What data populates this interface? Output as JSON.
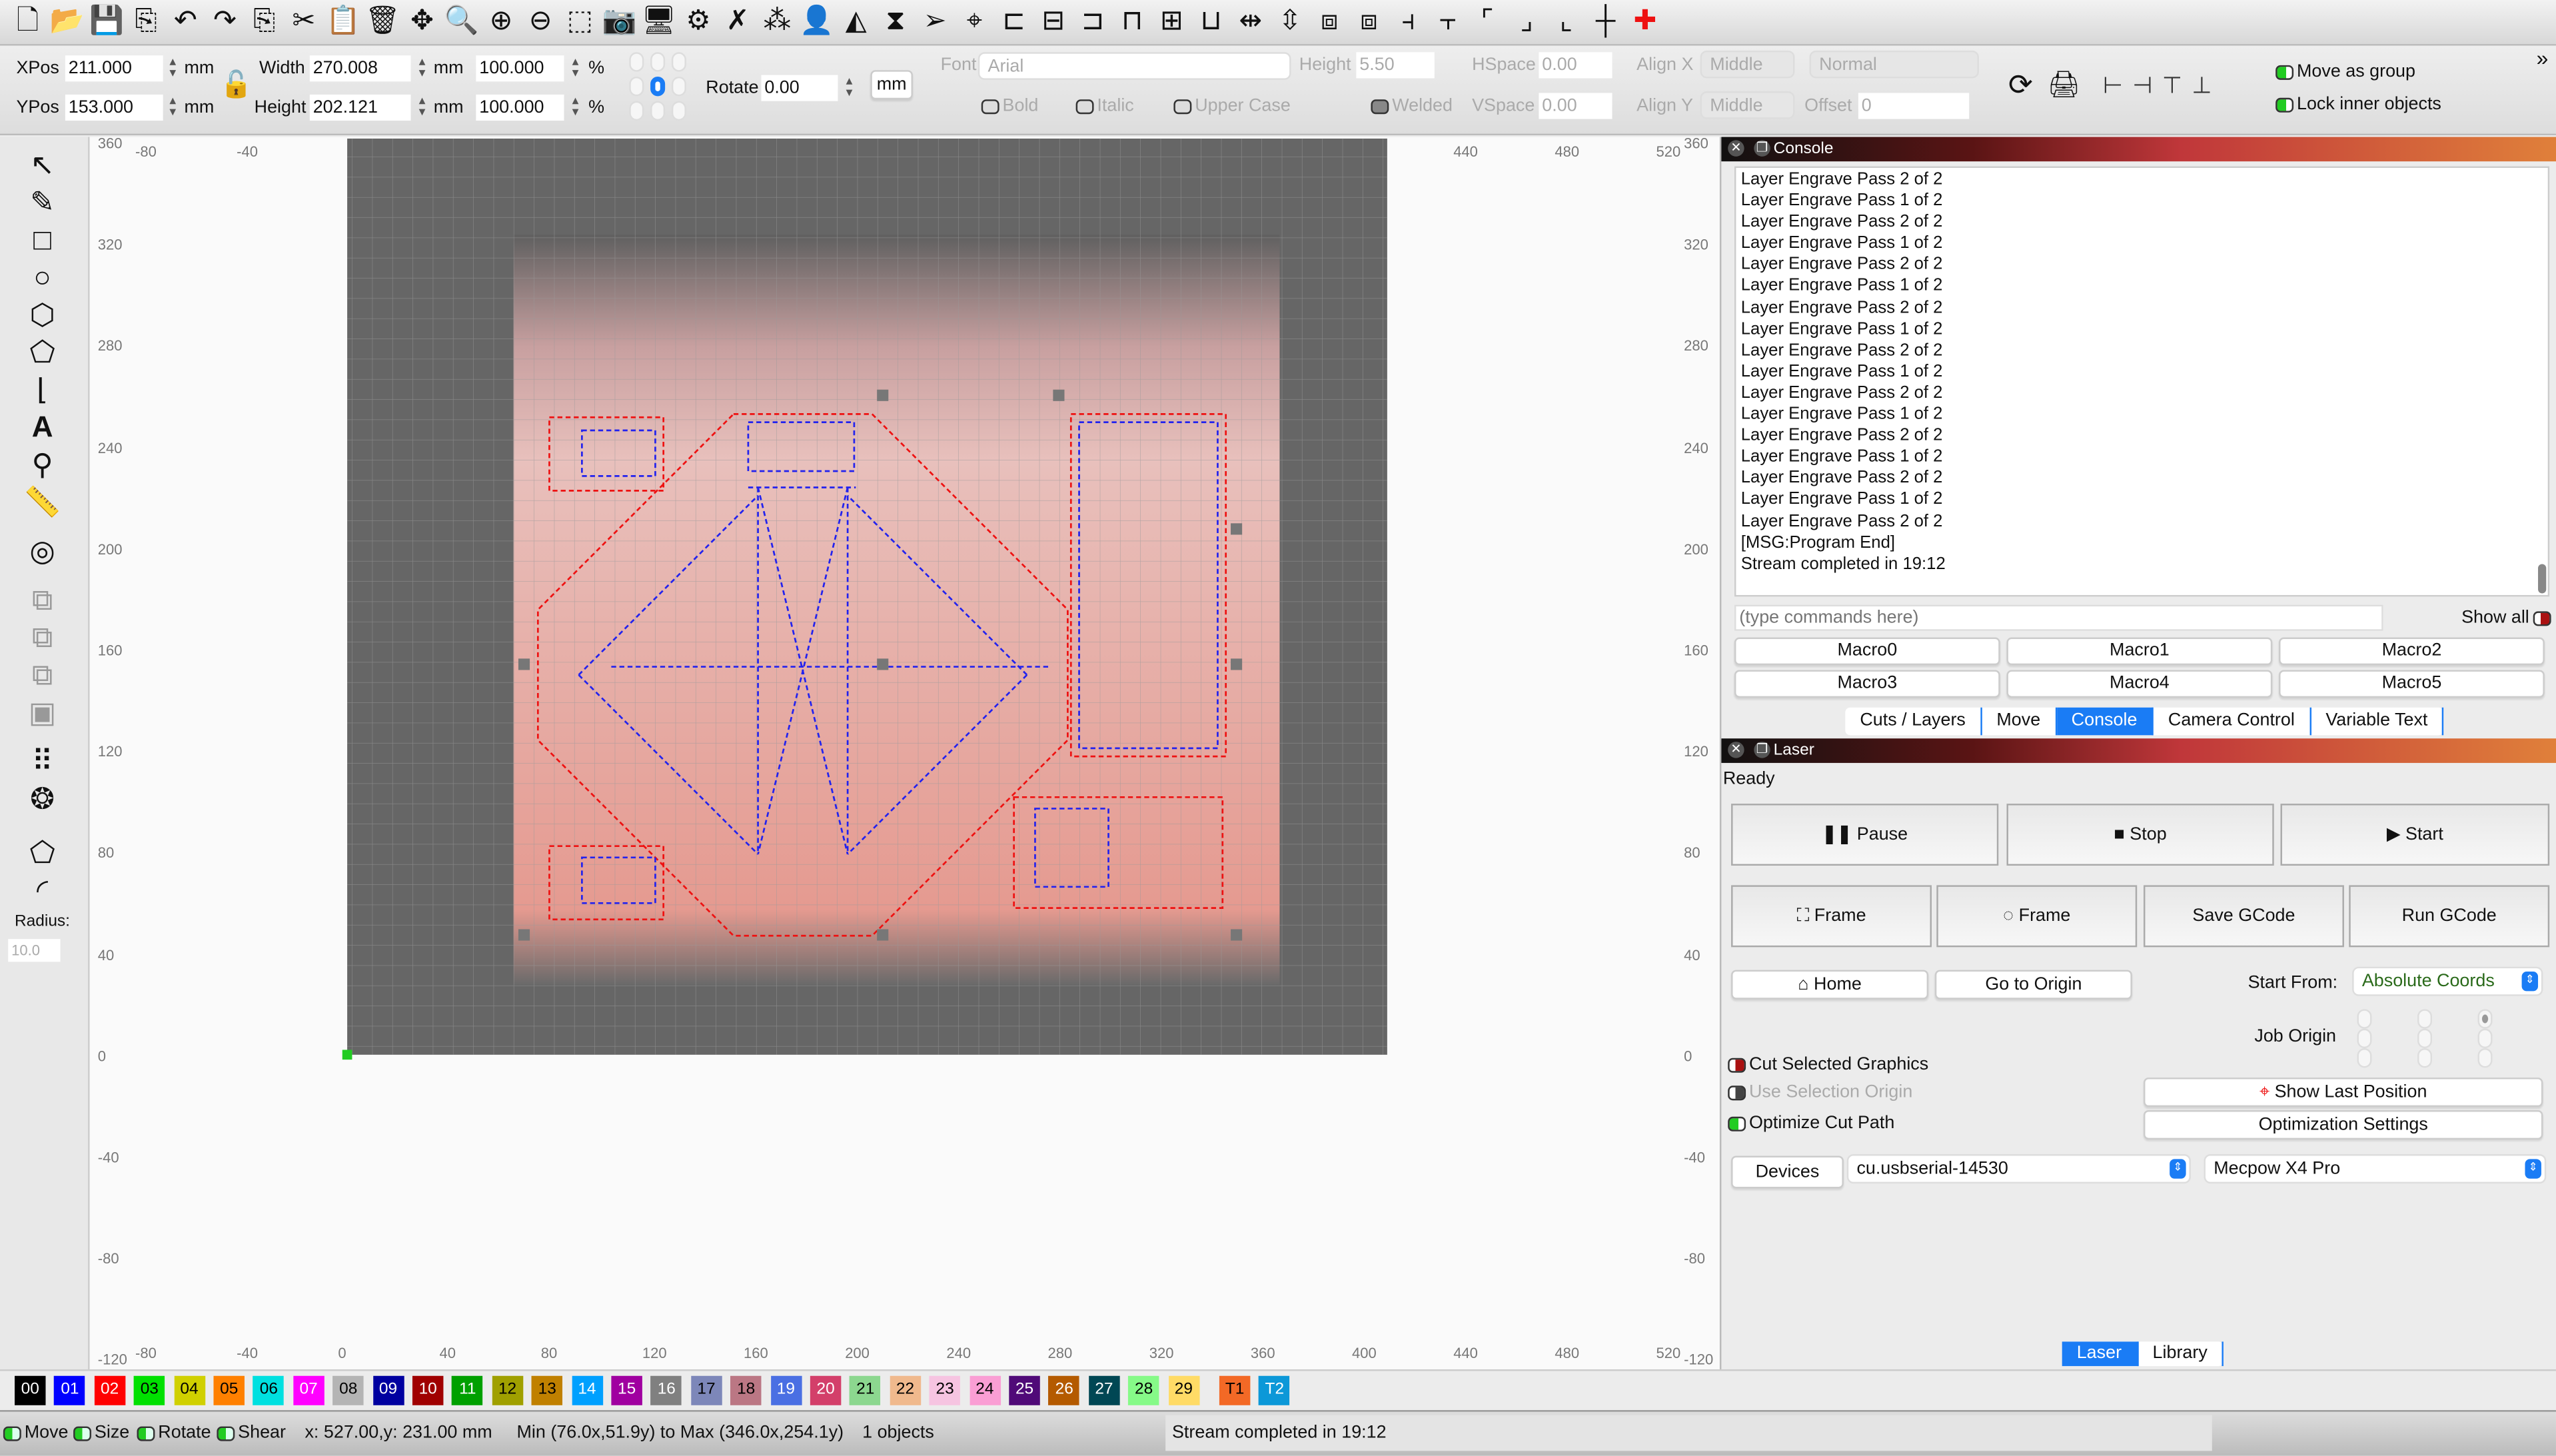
{
  "toolbar": {
    "icons": [
      "new-file-icon",
      "open-folder-icon",
      "save-icon",
      "import-icon",
      "undo-icon",
      "redo-icon",
      "copy-icon",
      "cut-icon",
      "paste-icon",
      "delete-icon",
      "move-icon",
      "zoom-fit-icon",
      "zoom-in-icon",
      "zoom-out-icon",
      "frame-selection-icon",
      "camera-icon",
      "monitor-icon",
      "settings-icon",
      "tools-icon",
      "group-icon",
      "user-icon",
      "mirror-horizontal-icon",
      "mirror-vertical-icon",
      "send-icon",
      "target-icon",
      "align-left-icon",
      "align-center-icon",
      "align-right-icon",
      "align-top-icon",
      "align-middle-icon",
      "align-bottom-icon",
      "distribute-h-icon",
      "distribute-v-icon",
      "move-together-h-icon",
      "move-together-v-icon",
      "dock-h-icon",
      "dock-v-icon",
      "corner-tl-icon",
      "corner-br-icon",
      "corner-bl-icon",
      "center-icon",
      "laser-position-icon"
    ]
  },
  "props": {
    "xpos_label": "XPos",
    "xpos": "211.000",
    "ypos_label": "YPos",
    "ypos": "153.000",
    "unit": "mm",
    "width_label": "Width",
    "width": "270.008",
    "height_label": "Height",
    "height": "202.121",
    "scale_w": "100.000",
    "scale_h": "100.000",
    "pct": "%",
    "rotate_label": "Rotate",
    "rotate": "0.00",
    "mm_button": "mm",
    "font_label": "Font",
    "font": "Arial",
    "font_height_label": "Height",
    "font_height": "5.50",
    "hspace_label": "HSpace",
    "hspace": "0.00",
    "vspace_label": "VSpace",
    "vspace": "0.00",
    "alignx_label": "Align X",
    "alignx": "Middle",
    "aligny_label": "Align Y",
    "aligny": "Middle",
    "style": "Normal",
    "offset_label": "Offset",
    "offset": "0",
    "bold": "Bold",
    "italic": "Italic",
    "upper": "Upper Case",
    "welded": "Welded",
    "move_group": "Move as group",
    "lock_inner": "Lock inner objects"
  },
  "left_tools": {
    "radius_label": "Radius:",
    "radius": "10.0"
  },
  "ruler": {
    "x_ticks": [
      "-80",
      "-40",
      "0",
      "40",
      "80",
      "120",
      "160",
      "200",
      "240",
      "280",
      "320",
      "360",
      "400",
      "440",
      "480",
      "520"
    ],
    "y_ticks": [
      "360",
      "320",
      "280",
      "240",
      "200",
      "160",
      "120",
      "80",
      "40",
      "0",
      "-40",
      "-80",
      "-120"
    ]
  },
  "console": {
    "title": "Console",
    "lines": [
      "Layer Engrave Pass 2 of 2",
      "Layer Engrave Pass 1 of 2",
      "Layer Engrave Pass 2 of 2",
      "Layer Engrave Pass 1 of 2",
      "Layer Engrave Pass 2 of 2",
      "Layer Engrave Pass 1 of 2",
      "Layer Engrave Pass 2 of 2",
      "Layer Engrave Pass 1 of 2",
      "Layer Engrave Pass 2 of 2",
      "Layer Engrave Pass 1 of 2",
      "Layer Engrave Pass 2 of 2",
      "Layer Engrave Pass 1 of 2",
      "Layer Engrave Pass 2 of 2",
      "Layer Engrave Pass 1 of 2",
      "Layer Engrave Pass 2 of 2",
      "Layer Engrave Pass 1 of 2",
      "Layer Engrave Pass 2 of 2",
      "[MSG:Program End]",
      "Stream completed in 19:12"
    ],
    "placeholder": "(type commands here)",
    "show_all": "Show all",
    "macros": [
      "Macro0",
      "Macro1",
      "Macro2",
      "Macro3",
      "Macro4",
      "Macro5"
    ]
  },
  "tabs": [
    {
      "label": "Cuts / Layers",
      "active": false
    },
    {
      "label": "Move",
      "active": false
    },
    {
      "label": "Console",
      "active": true
    },
    {
      "label": "Camera Control",
      "active": false
    },
    {
      "label": "Variable Text",
      "active": false
    }
  ],
  "laser": {
    "title": "Laser",
    "state": "Ready",
    "pause": "Pause",
    "stop": "Stop",
    "start": "Start",
    "frame1": "Frame",
    "frame2": "Frame",
    "save_gcode": "Save GCode",
    "run_gcode": "Run GCode",
    "home": "Home",
    "go_origin": "Go to Origin",
    "start_from_label": "Start From:",
    "start_from": "Absolute Coords",
    "job_origin_label": "Job Origin",
    "cut_selected": "Cut Selected Graphics",
    "use_sel_origin": "Use Selection Origin",
    "optimize": "Optimize Cut Path",
    "show_last": "Show Last Position",
    "opt_settings": "Optimization Settings",
    "devices": "Devices",
    "port": "cu.usbserial-14530",
    "device": "Mecpow X4 Pro"
  },
  "bottom_tabs": [
    {
      "label": "Laser",
      "active": true
    },
    {
      "label": "Library",
      "active": false
    }
  ],
  "palette": [
    {
      "l": "00",
      "c": "#000000",
      "t": "#fff"
    },
    {
      "l": "01",
      "c": "#0000ff",
      "t": "#fff"
    },
    {
      "l": "02",
      "c": "#ff0000",
      "t": "#fff"
    },
    {
      "l": "03",
      "c": "#00e000",
      "t": "#000"
    },
    {
      "l": "04",
      "c": "#d0d000",
      "t": "#000"
    },
    {
      "l": "05",
      "c": "#ff8000",
      "t": "#000"
    },
    {
      "l": "06",
      "c": "#00e0e0",
      "t": "#000"
    },
    {
      "l": "07",
      "c": "#ff00ff",
      "t": "#fff"
    },
    {
      "l": "08",
      "c": "#b4b4b4",
      "t": "#000"
    },
    {
      "l": "09",
      "c": "#0000a0",
      "t": "#fff"
    },
    {
      "l": "10",
      "c": "#a00000",
      "t": "#fff"
    },
    {
      "l": "11",
      "c": "#00a000",
      "t": "#fff"
    },
    {
      "l": "12",
      "c": "#a0a000",
      "t": "#000"
    },
    {
      "l": "13",
      "c": "#c08000",
      "t": "#000"
    },
    {
      "l": "14",
      "c": "#00a0ff",
      "t": "#fff"
    },
    {
      "l": "15",
      "c": "#a000a0",
      "t": "#fff"
    },
    {
      "l": "16",
      "c": "#808080",
      "t": "#fff"
    },
    {
      "l": "17",
      "c": "#7d87b9",
      "t": "#000"
    },
    {
      "l": "18",
      "c": "#bb7784",
      "t": "#000"
    },
    {
      "l": "19",
      "c": "#4a6fe3",
      "t": "#fff"
    },
    {
      "l": "20",
      "c": "#d33f6a",
      "t": "#fff"
    },
    {
      "l": "21",
      "c": "#8cd78f",
      "t": "#000"
    },
    {
      "l": "22",
      "c": "#f0b98d",
      "t": "#000"
    },
    {
      "l": "23",
      "c": "#f6c4e1",
      "t": "#000"
    },
    {
      "l": "24",
      "c": "#fa9ed4",
      "t": "#000"
    },
    {
      "l": "25",
      "c": "#500a78",
      "t": "#fff"
    },
    {
      "l": "26",
      "c": "#b45a00",
      "t": "#fff"
    },
    {
      "l": "27",
      "c": "#004754",
      "t": "#fff"
    },
    {
      "l": "28",
      "c": "#86fa88",
      "t": "#000"
    },
    {
      "l": "29",
      "c": "#ffdb66",
      "t": "#000"
    },
    {
      "l": "T1",
      "c": "#f36926",
      "t": "#000"
    },
    {
      "l": "T2",
      "c": "#0c98d8",
      "t": "#fff"
    }
  ],
  "status": {
    "move": "Move",
    "size": "Size",
    "rotate": "Rotate",
    "shear": "Shear",
    "coords": "x: 527.00,y: 231.00 mm",
    "bounds": "Min (76.0x,51.9y) to Max (346.0x,254.1y)",
    "objects": "1 objects",
    "message": "Stream completed in 19:12"
  },
  "colors": {
    "accent": "#1a7cf5",
    "toggle_on": "#22cc22",
    "toggle_off": "#aa1111"
  }
}
